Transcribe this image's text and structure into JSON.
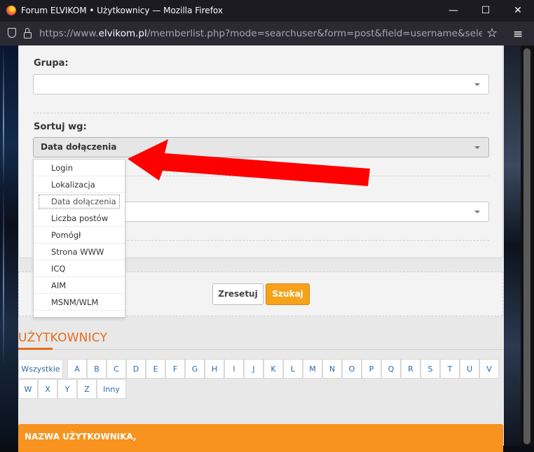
{
  "window": {
    "title": "Forum ELVIKOM • Użytkownicy — Mozilla Firefox",
    "minimize": "—",
    "maximize": "☐",
    "close": "✕"
  },
  "navbar": {
    "url_prefix": "https://www.",
    "url_host": "elvikom.pl",
    "url_rest": "/memberlist.php?mode=searchuser&form=post&field=username&select_single="
  },
  "form": {
    "group_label": "Grupa:",
    "group_value": "",
    "sort_label": "Sortuj wg:",
    "sort_value": "Data dołączenia",
    "order_value": "",
    "options": [
      "Login",
      "Lokalizacja",
      "Data dołączenia",
      "Liczba postów",
      "Pomógł",
      "Strona WWW",
      "ICQ",
      "AIM",
      "MSNM/WLM"
    ],
    "selected_option": "Data dołączenia"
  },
  "buttons": {
    "reset": "Zresetuj",
    "search": "Szukaj"
  },
  "section": {
    "title": "UŻYTKOWNICY"
  },
  "letters_row1": [
    "Wszystkie",
    "A",
    "B",
    "C",
    "D",
    "E",
    "F",
    "G",
    "H",
    "I",
    "J",
    "K",
    "L",
    "M",
    "N",
    "O",
    "P",
    "Q",
    "R",
    "S",
    "T",
    "U",
    "V"
  ],
  "letters_row2": [
    "W",
    "X",
    "Y",
    "Z",
    "Inny"
  ],
  "table": {
    "header": "NAZWA UŻYTKOWNIKA,"
  },
  "colors": {
    "accent": "#f7931e",
    "link": "#2d6aa8",
    "arrow": "#ff0000"
  }
}
